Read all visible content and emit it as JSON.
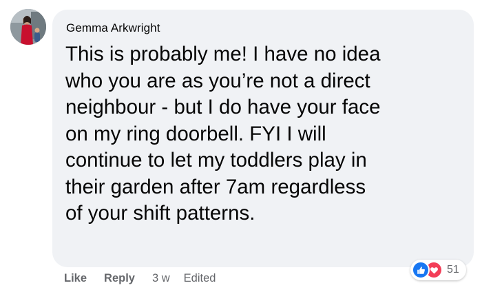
{
  "comment": {
    "author": "Gemma Arkwright",
    "lines": [
      "This is probably me! I have no idea",
      "who you are as you’re not a direct",
      "neighbour - but I do have your face",
      "on my ring doorbell. FYI I will",
      "continue to let my toddlers play in",
      "their garden after 7am regardless",
      "of your shift patterns."
    ],
    "avatar_icon": "profile-photo"
  },
  "actions": {
    "like_label": "Like",
    "reply_label": "Reply",
    "timestamp": "3 w",
    "edited_label": "Edited"
  },
  "reactions": {
    "icons": [
      "like-reaction-icon",
      "love-reaction-icon"
    ],
    "count": "51",
    "colors": {
      "like": "#1877f2",
      "love": "#f33e58"
    }
  }
}
